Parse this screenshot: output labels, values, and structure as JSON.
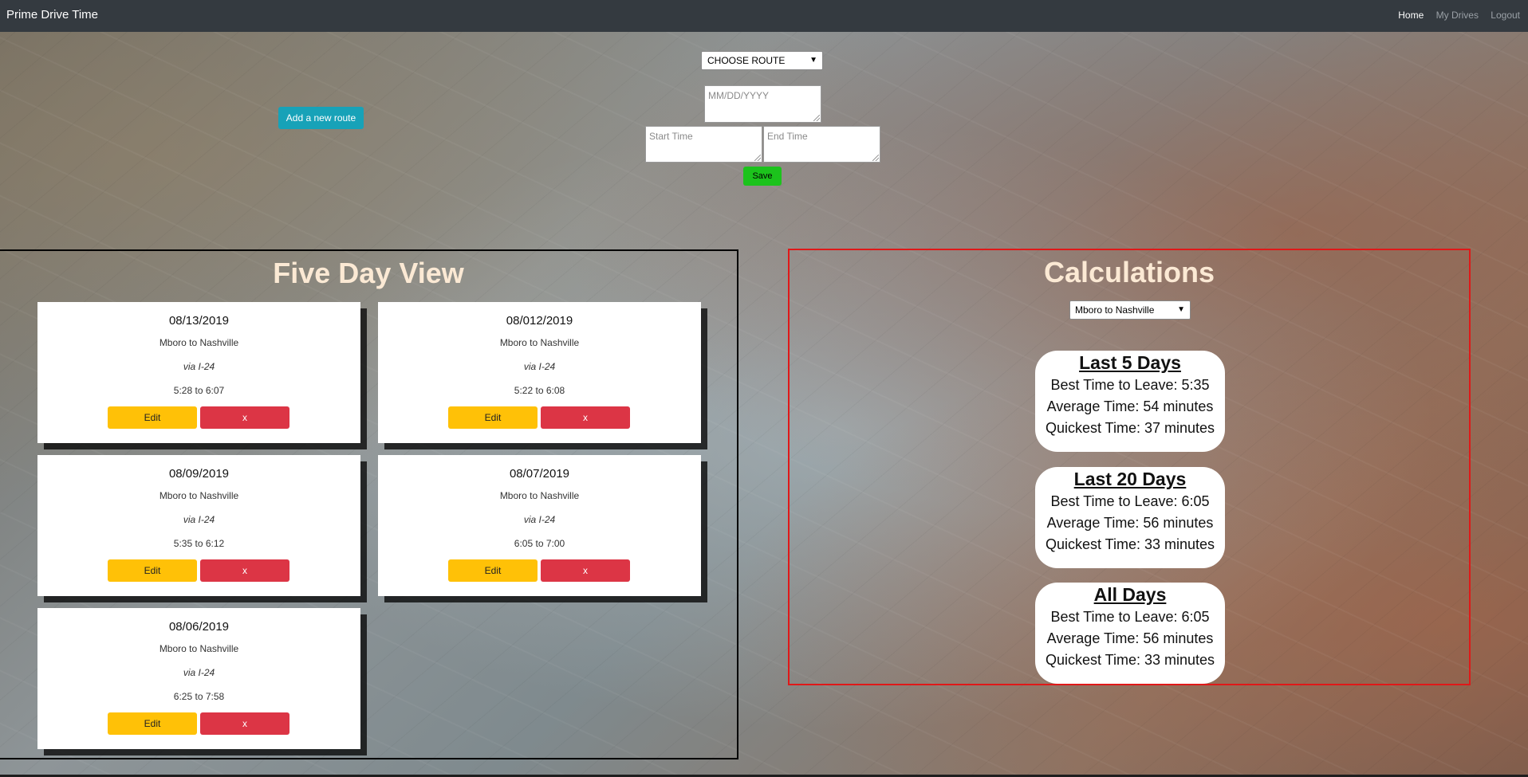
{
  "navbar": {
    "brand": "Prime Drive Time",
    "links": [
      "Home",
      "My Drives",
      "Logout"
    ]
  },
  "form": {
    "route_select": "CHOOSE ROUTE",
    "date_placeholder": "MM/DD/YYYY",
    "start_placeholder": "Start Time",
    "end_placeholder": "End Time",
    "save_label": "Save",
    "add_route_label": "Add a new route"
  },
  "five_day": {
    "title": "Five Day View",
    "cards": [
      {
        "date": "08/13/2019",
        "route": "Mboro to Nashville",
        "via": "via I-24",
        "times": "5:28 to 6:07",
        "edit": "Edit",
        "delete": "x"
      },
      {
        "date": "08/012/2019",
        "route": "Mboro to Nashville",
        "via": "via I-24",
        "times": "5:22 to 6:08",
        "edit": "Edit",
        "delete": "x"
      },
      {
        "date": "08/09/2019",
        "route": "Mboro to Nashville",
        "via": "via I-24",
        "times": "5:35 to 6:12",
        "edit": "Edit",
        "delete": "x"
      },
      {
        "date": "08/07/2019",
        "route": "Mboro to Nashville",
        "via": "via I-24",
        "times": "6:05 to 7:00",
        "edit": "Edit",
        "delete": "x"
      },
      {
        "date": "08/06/2019",
        "route": "Mboro to Nashville",
        "via": "via I-24",
        "times": "6:25 to 7:58",
        "edit": "Edit",
        "delete": "x"
      }
    ]
  },
  "calculations": {
    "title": "Calculations",
    "route_select": "Mboro to Nashville",
    "boxes": [
      {
        "heading": "Last 5 Days",
        "best": "Best Time to Leave: 5:35",
        "average": "Average Time: 54 minutes",
        "quickest": "Quickest Time: 37 minutes"
      },
      {
        "heading": "Last 20 Days",
        "best": "Best Time to Leave: 6:05",
        "average": "Average Time: 56 minutes",
        "quickest": "Quickest Time: 33 minutes"
      },
      {
        "heading": "All Days",
        "best": "Best Time to Leave: 6:05",
        "average": "Average Time: 56 minutes",
        "quickest": "Quickest Time: 33 minutes"
      }
    ]
  },
  "colors": {
    "navbar": "#343a40",
    "save": "#1cc31c",
    "add_route": "#17a2b8",
    "edit": "#ffc107",
    "delete": "#dc3545",
    "title": "#fbe9d4",
    "calc_border": "#e01818"
  }
}
